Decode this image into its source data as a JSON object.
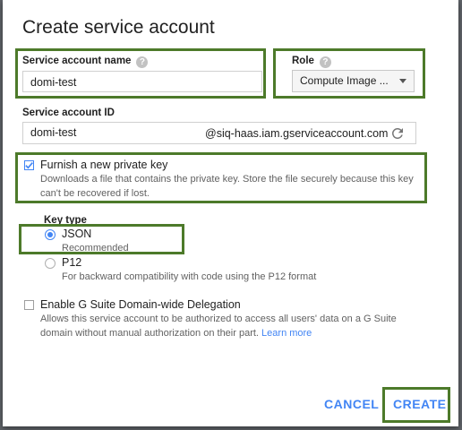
{
  "dialog": {
    "title": "Create service account",
    "service_account_name": {
      "label": "Service account name",
      "value": "domi-test"
    },
    "role": {
      "label": "Role",
      "selected": "Compute Image ..."
    },
    "service_account_id": {
      "label": "Service account ID",
      "value": "domi-test",
      "suffix": "@siq-haas.iam.gserviceaccount.com"
    },
    "furnish_key": {
      "label": "Furnish a new private key",
      "checked": true,
      "description_line1": "Downloads a file that contains the private key. Store the file securely because this key",
      "description_line2": "can't be recovered if lost."
    },
    "key_type": {
      "label": "Key type",
      "options": [
        {
          "label": "JSON",
          "note": "Recommended",
          "selected": true
        },
        {
          "label": "P12",
          "note": "For backward compatibility with code using the P12 format",
          "selected": false
        }
      ]
    },
    "gsuite": {
      "label": "Enable G Suite Domain-wide Delegation",
      "checked": false,
      "description_line1": "Allows this service account to be authorized to access all users' data on a G Suite",
      "description_line2": "domain without manual authorization on their part.",
      "link": "Learn more"
    },
    "buttons": {
      "cancel": "CANCEL",
      "create": "CREATE"
    }
  },
  "colors": {
    "accent": "#4285f4",
    "highlight_box": "#4d7a2a"
  },
  "icons": [
    "help-icon",
    "chevron-down-icon",
    "refresh-icon",
    "checkmark-icon"
  ]
}
